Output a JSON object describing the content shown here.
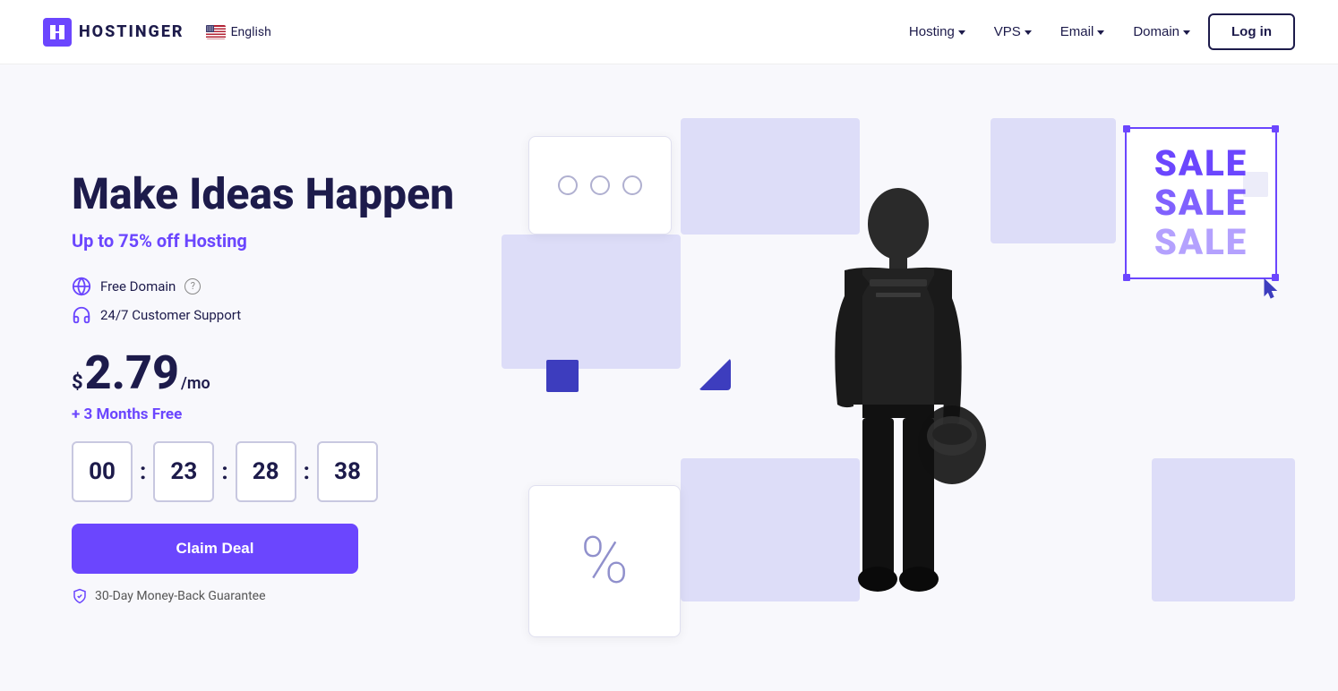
{
  "brand": {
    "name": "HOSTINGER",
    "logo_alt": "Hostinger logo"
  },
  "language": {
    "label": "English",
    "flag": "us"
  },
  "nav": {
    "items": [
      {
        "id": "hosting",
        "label": "Hosting",
        "has_dropdown": true
      },
      {
        "id": "vps",
        "label": "VPS",
        "has_dropdown": true
      },
      {
        "id": "email",
        "label": "Email",
        "has_dropdown": true
      },
      {
        "id": "domain",
        "label": "Domain",
        "has_dropdown": true
      }
    ],
    "login_label": "Log in"
  },
  "hero": {
    "title": "Make Ideas Happen",
    "subtitle_prefix": "Up to ",
    "discount": "75%",
    "subtitle_suffix": " off Hosting",
    "features": [
      {
        "id": "domain",
        "text": "Free Domain",
        "has_info": true
      },
      {
        "id": "support",
        "text": "24/7 Customer Support"
      }
    ],
    "price": {
      "currency": "$",
      "amount": "2.79",
      "period": "/mo"
    },
    "promo_note": "+ 3 Months Free",
    "countdown": {
      "hours": "00",
      "minutes": "23",
      "seconds": "28",
      "frames": "38"
    },
    "cta_label": "Claim Deal",
    "guarantee": "30-Day Money-Back Guarantee"
  },
  "sale_display": {
    "lines": [
      "SALE",
      "SALE",
      "SALE"
    ]
  },
  "colors": {
    "brand_purple": "#6b46fe",
    "dark_navy": "#1d1b4b",
    "lavender": "#ddddf8",
    "dark_purple_sq": "#3d3dbe"
  }
}
